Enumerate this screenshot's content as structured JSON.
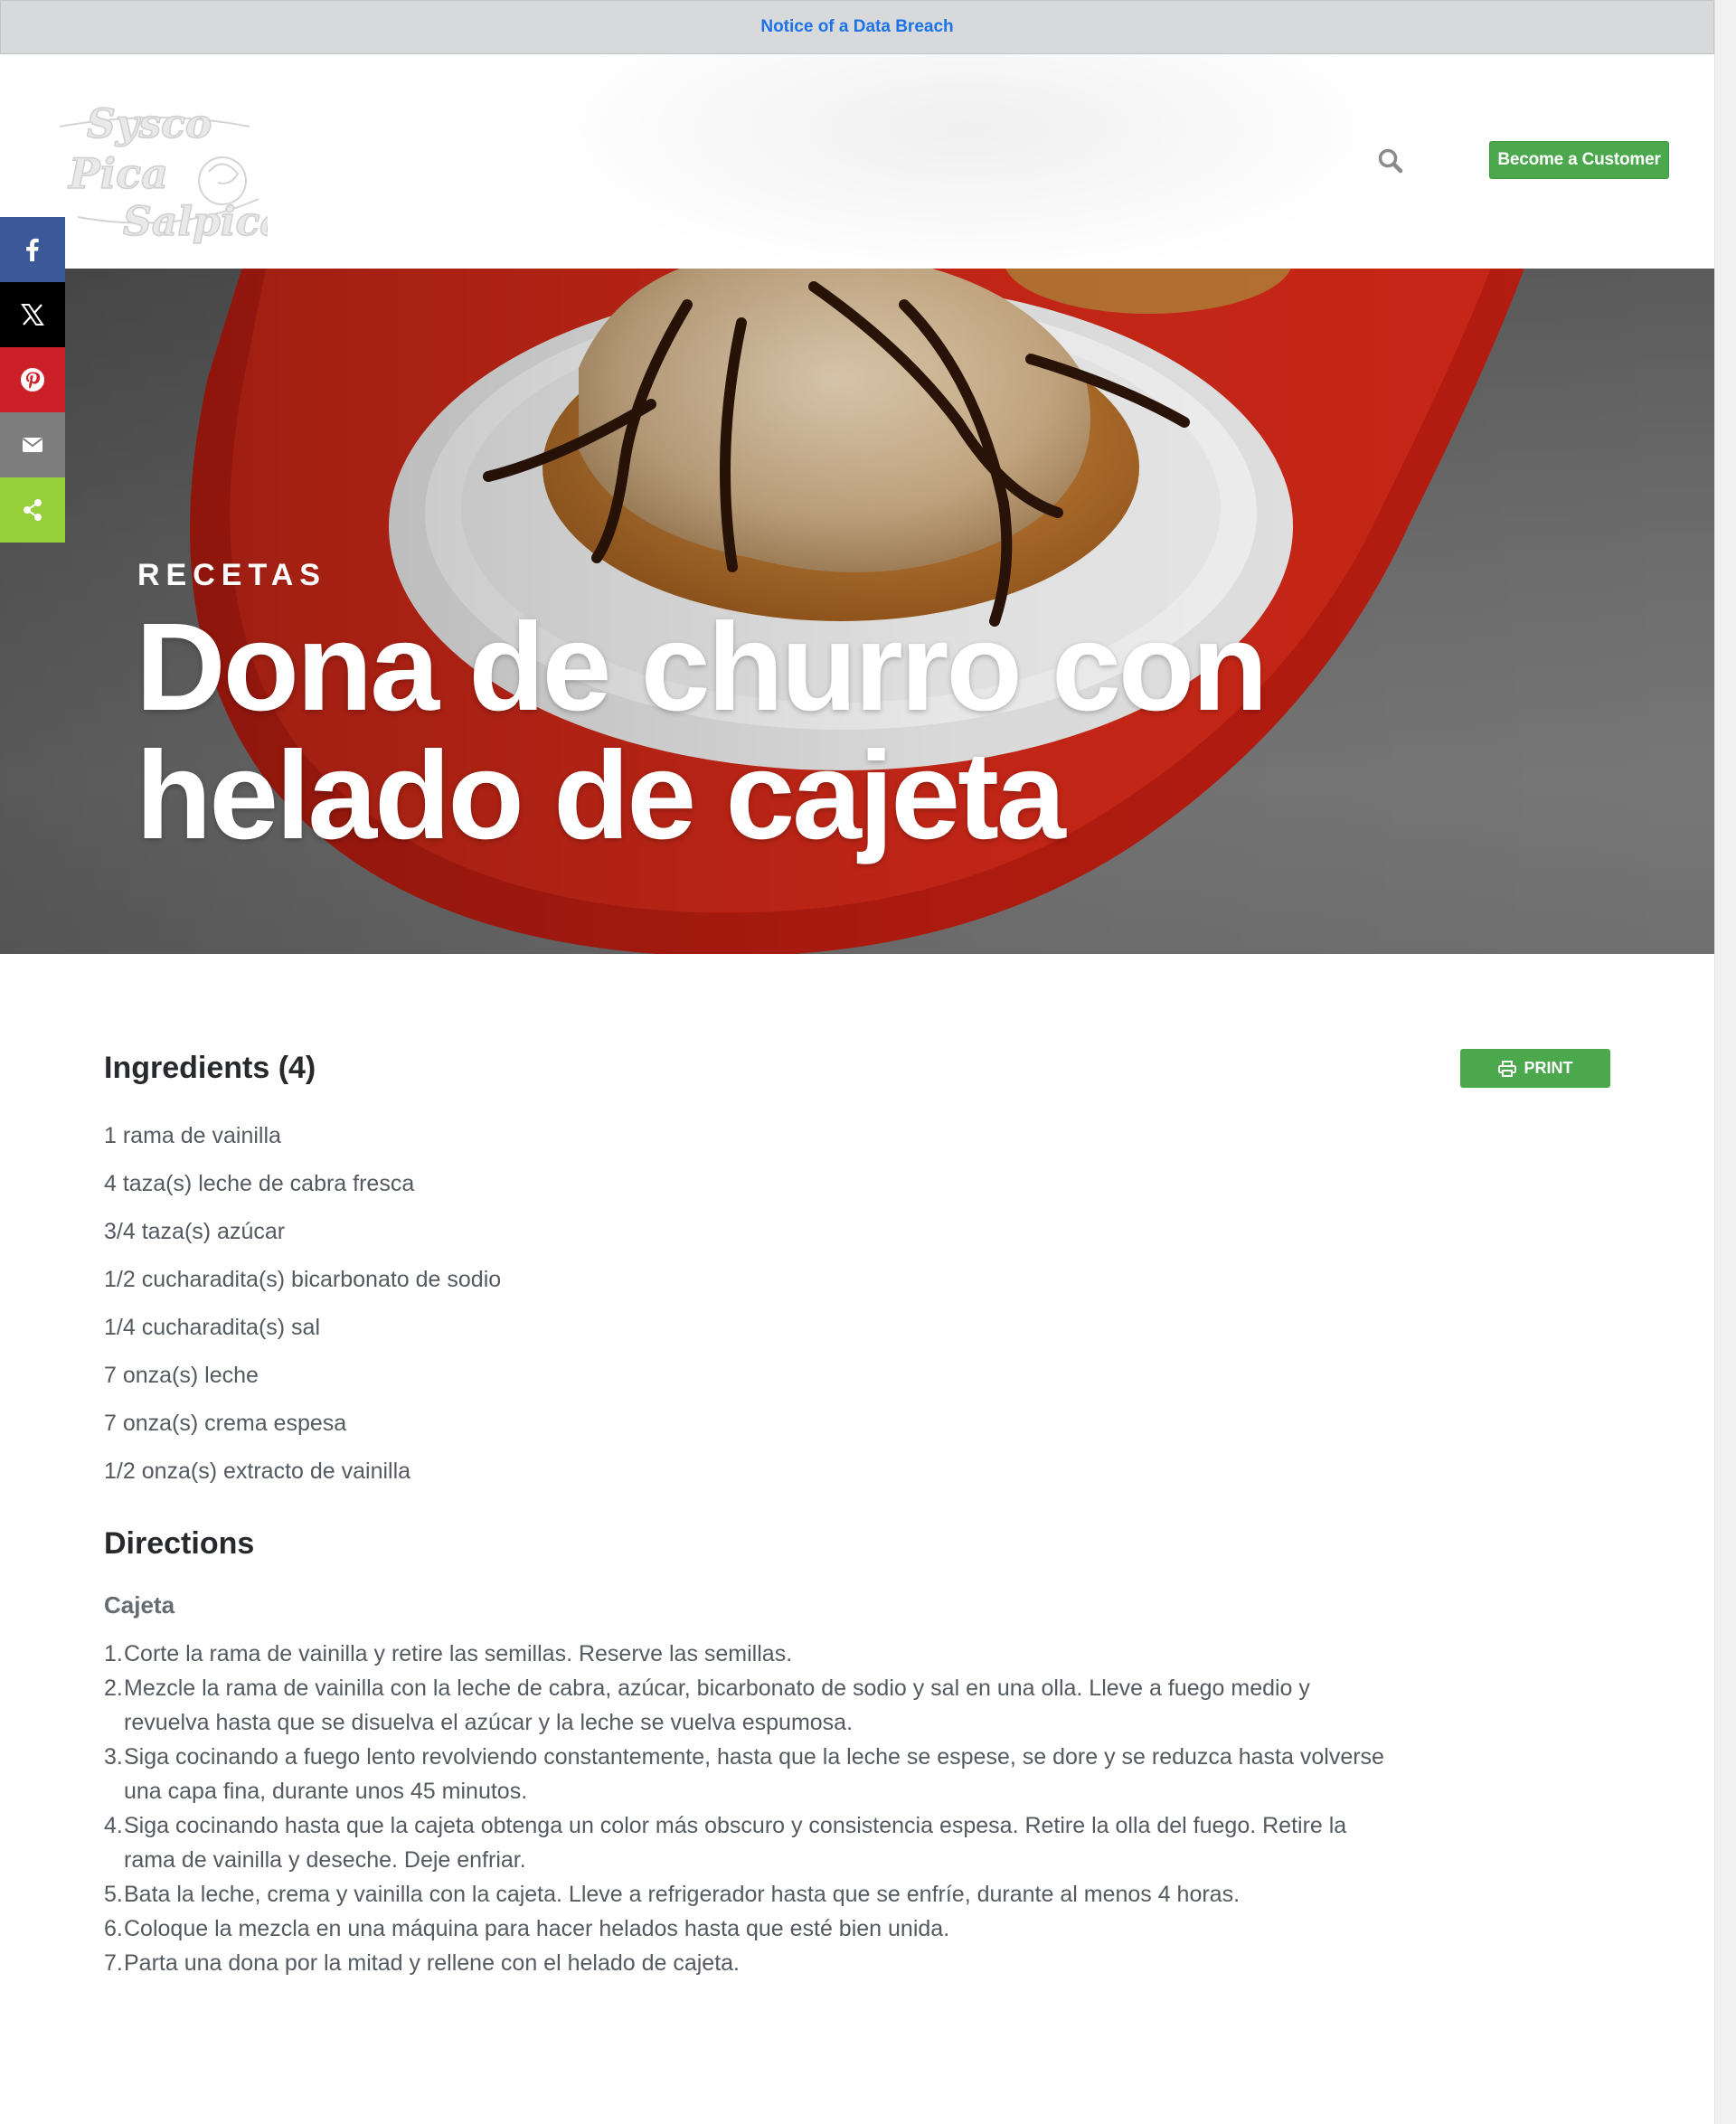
{
  "notice": {
    "text": "Notice of a Data Breach"
  },
  "header": {
    "logo": {
      "line1": "Sysco",
      "line2": "Pica",
      "line3": "Salpica"
    },
    "search_icon": "search-icon",
    "cta_label": "Become a Customer"
  },
  "social": [
    {
      "name": "facebook",
      "icon": "facebook-icon",
      "color": "#3b5998"
    },
    {
      "name": "x",
      "icon": "x-icon",
      "color": "#000000"
    },
    {
      "name": "pinterest",
      "icon": "pinterest-icon",
      "color": "#cb2027"
    },
    {
      "name": "email",
      "icon": "email-icon",
      "color": "#7d7d7d"
    },
    {
      "name": "share",
      "icon": "share-icon",
      "color": "#95d03a"
    }
  ],
  "hero": {
    "eyebrow": "Recetas",
    "title_line1": "Dona de churro con",
    "title_line2": "helado de cajeta"
  },
  "recipe": {
    "ingredients_heading": "Ingredients (4)",
    "print_label": "PRINT",
    "print_icon": "printer-icon",
    "ingredients": [
      "1 rama de vainilla",
      "4 taza(s) leche de cabra fresca",
      "3/4 taza(s) azúcar",
      "1/2 cucharadita(s) bicarbonato de sodio",
      "1/4 cucharadita(s) sal",
      "7 onza(s) leche",
      "7 onza(s) crema espesa",
      "1/2 onza(s) extracto de vainilla"
    ],
    "directions_heading": "Directions",
    "section_title": "Cajeta",
    "steps": [
      "Corte la rama de vainilla y retire las semillas. Reserve las semillas.",
      "Mezcle la rama de vainilla con la leche de cabra, azúcar, bicarbonato de sodio y sal en una olla. Lleve a fuego medio y revuelva hasta que se disuelva el azúcar y la leche se vuelva espumosa.",
      "Siga cocinando a fuego lento revolviendo constantemente, hasta que la leche se espese, se dore y se reduzca hasta volverse una capa fina, durante unos 45 minutos.",
      "Siga cocinando hasta que la cajeta obtenga un color más obscuro y consistencia espesa. Retire la olla del fuego. Retire la rama de vainilla y deseche. Deje enfriar.",
      "Bata la leche, crema y vainilla con la cajeta. Lleve a refrigerador hasta que se enfríe, durante al menos 4 horas.",
      "Coloque la mezcla en una máquina para hacer helados hasta que esté bien unida.",
      "Parta una dona por la mitad y rellene con el helado de cajeta."
    ]
  },
  "colors": {
    "accent_green": "#4ca84c",
    "link_blue": "#1a73e8",
    "heading_dark": "#27292c",
    "body_gray": "#555a60"
  }
}
